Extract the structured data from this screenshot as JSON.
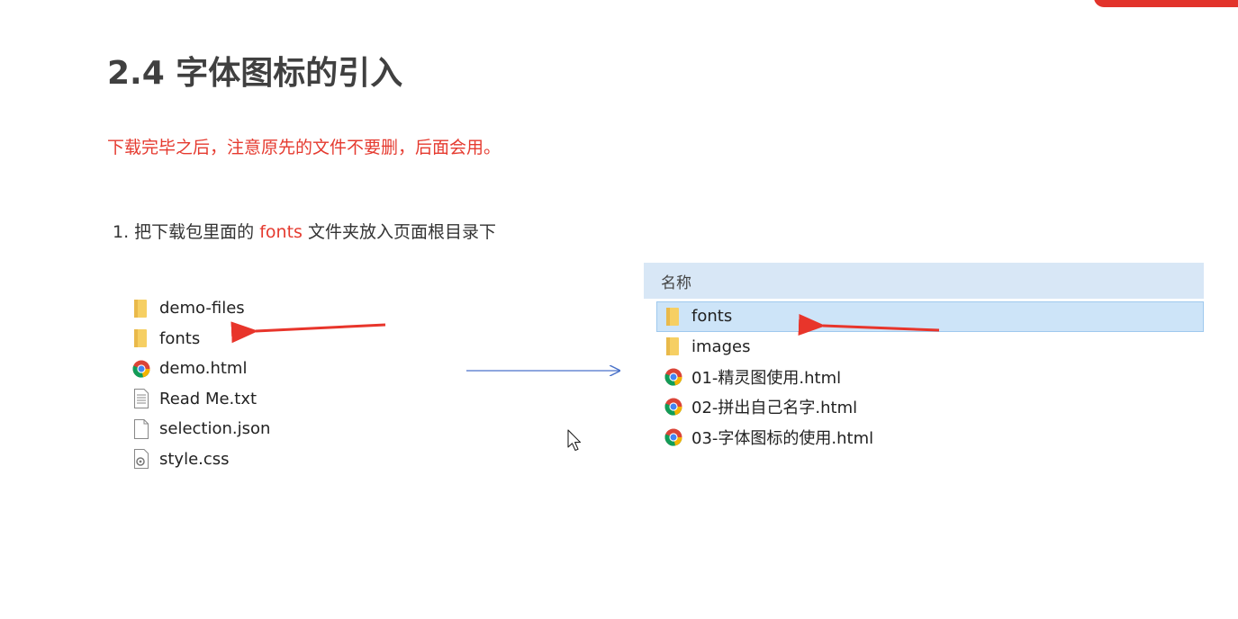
{
  "slide": {
    "title": "2.4 字体图标的引入",
    "notice": "下载完毕之后，注意原先的文件不要删，后面会用。",
    "step": {
      "prefix": "1. 把下载包里面的 ",
      "highlight": "fonts",
      "suffix": " 文件夹放入页面根目录下"
    }
  },
  "left_listing": {
    "items": [
      {
        "name": "demo-files",
        "icon": "folder-icon"
      },
      {
        "name": "fonts",
        "icon": "folder-icon"
      },
      {
        "name": "demo.html",
        "icon": "chrome-icon"
      },
      {
        "name": "Read Me.txt",
        "icon": "text-file-icon"
      },
      {
        "name": "selection.json",
        "icon": "blank-file-icon"
      },
      {
        "name": "style.css",
        "icon": "css-file-icon"
      }
    ]
  },
  "explorer": {
    "column_header": "名称",
    "items": [
      {
        "name": "fonts",
        "icon": "folder-icon",
        "selected": true
      },
      {
        "name": "images",
        "icon": "folder-icon",
        "selected": false
      },
      {
        "name": "01-精灵图使用.html",
        "icon": "chrome-icon",
        "selected": false
      },
      {
        "name": "02-拼出自己名字.html",
        "icon": "chrome-icon",
        "selected": false
      },
      {
        "name": "03-字体图标的使用.html",
        "icon": "chrome-icon",
        "selected": false
      }
    ]
  },
  "colors": {
    "accent_red": "#e53a2f",
    "connector_blue": "#4a72c9",
    "header_blue": "#d8e7f6",
    "folder_yellow": "#f6cf63"
  }
}
